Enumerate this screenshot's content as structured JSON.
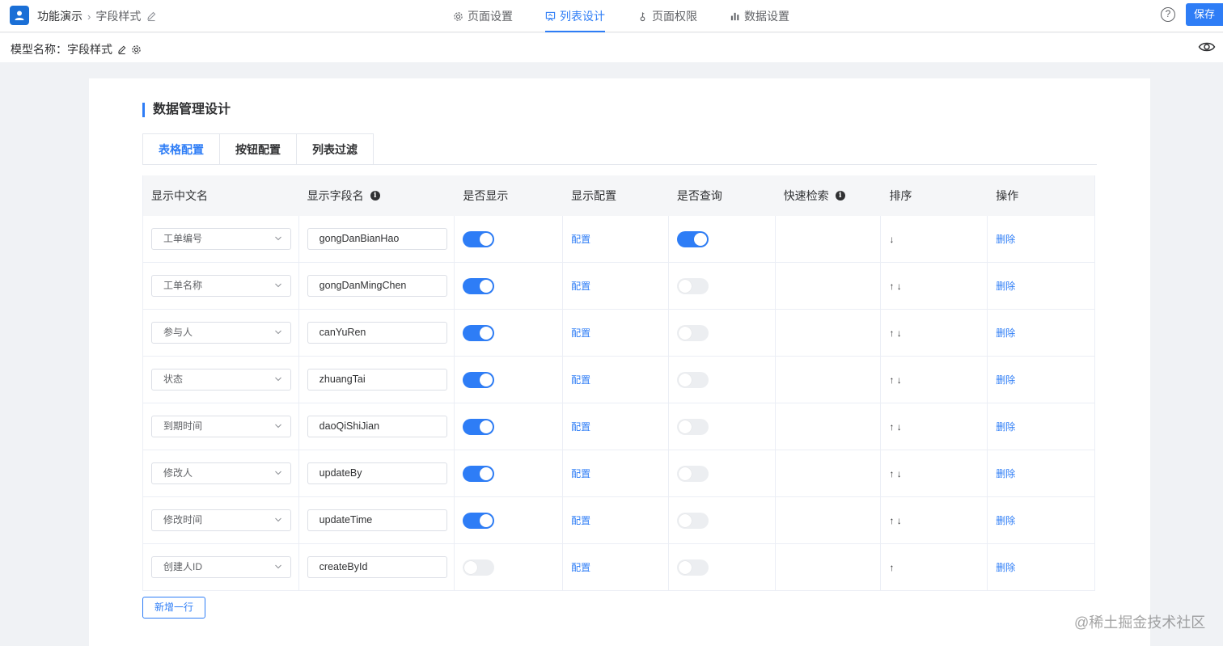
{
  "header": {
    "breadcrumb": [
      "功能演示",
      "字段样式"
    ],
    "tabs": [
      {
        "label": "页面设置",
        "icon": "gear-icon"
      },
      {
        "label": "列表设计",
        "icon": "list-design-icon"
      },
      {
        "label": "页面权限",
        "icon": "key-icon"
      },
      {
        "label": "数据设置",
        "icon": "bar-chart-icon"
      }
    ],
    "help_label": "?",
    "save_label": "保存"
  },
  "subheader": {
    "model_name": "模型名称：字段样式"
  },
  "main": {
    "section_title": "数据管理设计",
    "tabs": [
      "表格配置",
      "按钮配置",
      "列表过滤"
    ],
    "table": {
      "headers": [
        "显示中文名",
        "显示字段名",
        "是否显示",
        "显示配置",
        "是否查询",
        "快速检索",
        "排序",
        "操作"
      ],
      "rows": [
        {
          "cn_name": "工单编号",
          "field": "gongDanBianHao",
          "show": true,
          "config": "配置",
          "query": true,
          "sort": "↓",
          "action": "删除"
        },
        {
          "cn_name": "工单名称",
          "field": "gongDanMingChen",
          "show": true,
          "config": "配置",
          "query": false,
          "sort": "↑ ↓",
          "action": "删除"
        },
        {
          "cn_name": "参与人",
          "field": "canYuRen",
          "show": true,
          "config": "配置",
          "query": false,
          "sort": "↑ ↓",
          "action": "删除"
        },
        {
          "cn_name": "状态",
          "field": "zhuangTai",
          "show": true,
          "config": "配置",
          "query": false,
          "sort": "↑ ↓",
          "action": "删除"
        },
        {
          "cn_name": "到期时间",
          "field": "daoQiShiJian",
          "show": true,
          "config": "配置",
          "query": false,
          "sort": "↑ ↓",
          "action": "删除"
        },
        {
          "cn_name": "修改人",
          "field": "updateBy",
          "show": true,
          "config": "配置",
          "query": false,
          "sort": "↑ ↓",
          "action": "删除"
        },
        {
          "cn_name": "修改时间",
          "field": "updateTime",
          "show": true,
          "config": "配置",
          "query": false,
          "sort": "↑ ↓",
          "action": "删除"
        },
        {
          "cn_name": "创建人ID",
          "field": "createById",
          "show": false,
          "config": "配置",
          "query": false,
          "sort": "↑",
          "action": "删除"
        }
      ]
    },
    "add_row_label": "新增一行"
  },
  "watermark": "@稀土掘金技术社区",
  "colors": {
    "accent": "#2e7df6",
    "logo": "#1a6fd6"
  }
}
